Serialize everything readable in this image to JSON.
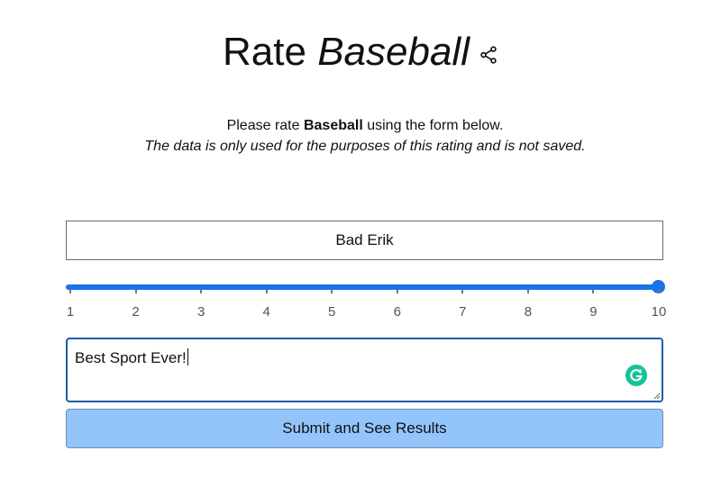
{
  "title": {
    "prefix": "Rate",
    "subject": "Baseball"
  },
  "intro": {
    "before": "Please rate ",
    "subject": "Baseball",
    "after": " using the form below.",
    "note": "The data is only used for the purposes of this rating and is not saved."
  },
  "name_field": {
    "value": "Bad Erik"
  },
  "rating_slider": {
    "min": 1,
    "max": 10,
    "value": 10,
    "ticks": [
      "1",
      "2",
      "3",
      "4",
      "5",
      "6",
      "7",
      "8",
      "9",
      "10"
    ],
    "accent_color": "#1a73e8"
  },
  "comment_field": {
    "value": "Best Sport Ever!"
  },
  "submit": {
    "label": "Submit and See Results",
    "color": "#93c5fb"
  },
  "icons": {
    "share": "share-icon",
    "grammarly": "grammarly-icon"
  }
}
